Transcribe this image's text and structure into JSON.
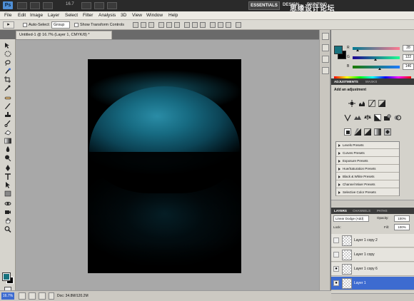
{
  "app": {
    "logo": "Ps",
    "zoom": "16.7",
    "workspaces": [
      "ESSENTIALS",
      "DESIGN",
      "PAINTING"
    ],
    "watermark": "思缘设计论坛"
  },
  "menu": [
    "File",
    "Edit",
    "Image",
    "Layer",
    "Select",
    "Filter",
    "Analysis",
    "3D",
    "View",
    "Window",
    "Help"
  ],
  "options": {
    "auto_select_label": "Auto-Select:",
    "auto_select_value": "Group",
    "show_transform_label": "Show Transform Controls"
  },
  "document": {
    "tab_title": "Untitled-1 @ 16.7% (Layer 1, CMYK/8) *"
  },
  "statusbar": {
    "zoom": "16.7%",
    "doc_info": "Doc: 34.8M/120.2M"
  },
  "color_panel": {
    "tabs": [
      "COLOR",
      "SWATCHES",
      "STYLES"
    ],
    "fg_color": "#17727e",
    "bg_color": "#000000",
    "r_label": "R",
    "g_label": "G",
    "b_label": "B",
    "r": "28",
    "g": "122",
    "b": "146"
  },
  "adjustments": {
    "tabs": [
      "ADJUSTMENTS",
      "MASKS"
    ],
    "title": "Add an adjustment",
    "presets": [
      "Levels Presets",
      "Curves Presets",
      "Exposure Presets",
      "Hue/Saturation Presets",
      "Black & White Presets",
      "Channel Mixer Presets",
      "Selective Color Presets"
    ]
  },
  "layers": {
    "tabs": [
      "LAYERS",
      "CHANNELS",
      "PATHS"
    ],
    "blend_mode": "Linear Dodge (Add)",
    "opacity_label": "Opacity:",
    "opacity": "100%",
    "lock_label": "Lock:",
    "fill_label": "Fill:",
    "fill": "100%",
    "items": [
      {
        "name": "Layer 1 copy 2",
        "visible": false,
        "active": false
      },
      {
        "name": "Layer 1 copy",
        "visible": false,
        "active": false
      },
      {
        "name": "Layer 1 copy 6",
        "visible": true,
        "active": false
      },
      {
        "name": "Layer 1",
        "visible": true,
        "active": true
      }
    ]
  }
}
